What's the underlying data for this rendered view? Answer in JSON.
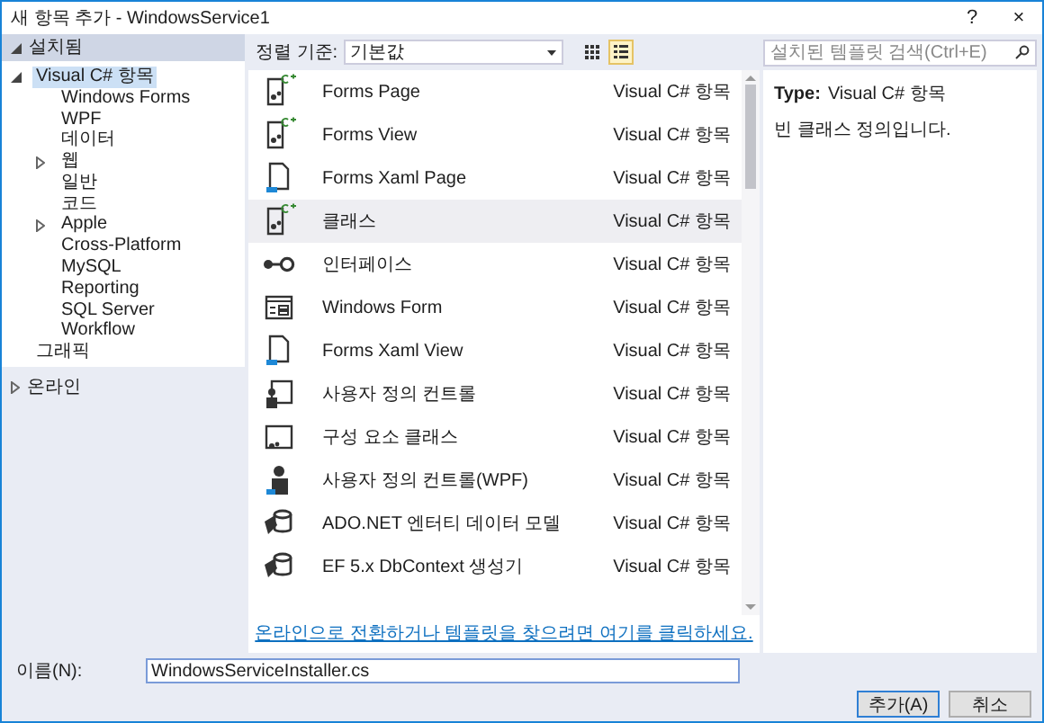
{
  "window": {
    "title": "새 항목 추가 - WindowsService1",
    "controls": [
      "?",
      "×"
    ]
  },
  "sidebar": {
    "installed": {
      "label": "설치됨",
      "expanded": true,
      "children": [
        {
          "label": "Visual C# 항목",
          "expanded": true,
          "selected": true,
          "children": [
            {
              "label": "Windows Forms",
              "selected": false
            },
            {
              "label": "WPF",
              "selected": false
            },
            {
              "label": "데이터",
              "selected": false
            },
            {
              "label": "웹",
              "expanded": false,
              "selected": false
            },
            {
              "label": "일반",
              "selected": false
            },
            {
              "label": "코드",
              "selected": false
            },
            {
              "label": "Apple",
              "expanded": false,
              "selected": false
            },
            {
              "label": "Cross-Platform",
              "selected": false
            },
            {
              "label": "MySQL",
              "selected": false
            },
            {
              "label": "Reporting",
              "selected": false
            },
            {
              "label": "SQL Server",
              "selected": false
            },
            {
              "label": "Workflow",
              "selected": false
            }
          ]
        },
        {
          "label": "그래픽",
          "selected": false
        }
      ]
    },
    "online": {
      "label": "온라인",
      "expanded": false
    }
  },
  "toolbar": {
    "sort_label": "정렬 기준:",
    "sort_value": "기본값",
    "views": [
      {
        "kind": "grid",
        "selected": false
      },
      {
        "kind": "list",
        "selected": true
      }
    ]
  },
  "search": {
    "placeholder": "설치된 템플릿 검색(Ctrl+E)"
  },
  "templates": [
    {
      "kind": "csharp",
      "name": "Forms Page",
      "category": "Visual C# 항목",
      "selected": false
    },
    {
      "kind": "csharp",
      "name": "Forms View",
      "category": "Visual C# 항목",
      "selected": false
    },
    {
      "kind": "xaml",
      "name": "Forms Xaml Page",
      "category": "Visual C# 항목",
      "selected": false
    },
    {
      "kind": "csharp",
      "name": "클래스",
      "category": "Visual C# 항목",
      "selected": true
    },
    {
      "kind": "interface",
      "name": "인터페이스",
      "category": "Visual C# 항목",
      "selected": false
    },
    {
      "kind": "form",
      "name": "Windows Form",
      "category": "Visual C# 항목",
      "selected": false
    },
    {
      "kind": "xaml",
      "name": "Forms Xaml View",
      "category": "Visual C# 항목",
      "selected": false
    },
    {
      "kind": "usercontrol",
      "name": "사용자 정의 컨트롤",
      "category": "Visual C# 항목",
      "selected": false
    },
    {
      "kind": "component",
      "name": "구성 요소 클래스",
      "category": "Visual C# 항목",
      "selected": false
    },
    {
      "kind": "wpf",
      "name": "사용자 정의 컨트롤(WPF)",
      "category": "Visual C# 항목",
      "selected": false
    },
    {
      "kind": "entity",
      "name": "ADO.NET 엔터티 데이터 모델",
      "category": "Visual C# 항목",
      "selected": false
    },
    {
      "kind": "entity",
      "name": "EF 5.x DbContext 생성기",
      "category": "Visual C# 항목",
      "selected": false
    }
  ],
  "online_link": "온라인으로 전환하거나 템플릿을 찾으려면 여기를 클릭하세요.",
  "details": {
    "type_label": "Type:",
    "type_value": "Visual C# 항목",
    "description": "빈 클래스 정의입니다."
  },
  "name_field": {
    "label": "이름(N):",
    "value": "WindowsServiceInstaller.cs"
  },
  "buttons": [
    {
      "label": "추가(A)",
      "default": true
    },
    {
      "label": "취소",
      "default": false
    }
  ]
}
